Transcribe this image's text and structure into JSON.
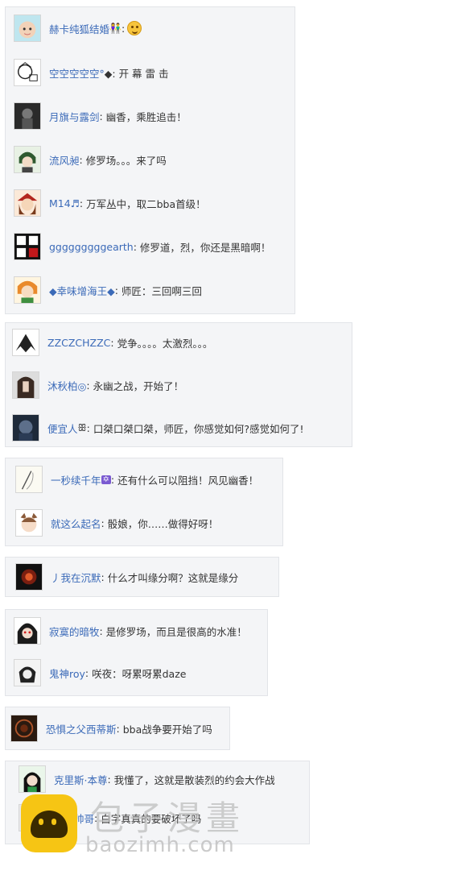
{
  "colors": {
    "username": "#3b6ab8",
    "box_bg": "#f4f5f7",
    "box_border": "#e2e4e8",
    "text": "#333333"
  },
  "groups": [
    {
      "comments": [
        {
          "user": "赫卡纯狐结婚",
          "user_badge": "👫",
          "text": "",
          "emoticon": "face-emoticon-icon"
        },
        {
          "user": "空空空空空°",
          "user_badge": "",
          "text": "◆: 开 幕 雷 击"
        },
        {
          "user": "月旗与露剑",
          "user_badge": "",
          "text": "幽香，乘胜追击！"
        },
        {
          "user": "流风昶",
          "user_badge": "",
          "text": "修罗场。。。来了吗"
        },
        {
          "user": "M14♬",
          "user_badge": "",
          "text": "万军丛中，取二bba首级！"
        },
        {
          "user": "gggggggggearth",
          "user_badge": "",
          "text": "修罗道，烈，你还是黑暗啊！"
        },
        {
          "user": "◆幸味增海王◆",
          "user_badge": "",
          "text": "师匠：三回啊三回"
        }
      ]
    },
    {
      "comments": [
        {
          "user": "ZZCZCHZZC",
          "user_badge": "",
          "text": "党争。。。。太激烈。。。"
        },
        {
          "user": "沐秋柏◎",
          "user_badge": "",
          "text": "永幽之战，开始了！"
        },
        {
          "user": "便宜人",
          "user_badge": "ꕥ",
          "text": "口桀口桀口桀，师匠，你感觉如何?感觉如何了!"
        }
      ]
    },
    {
      "comments": [
        {
          "user": "一秒续千年",
          "user_badge": "✡",
          "text": "还有什么可以阻挡！风见幽香！"
        },
        {
          "user": "就这么起名",
          "user_badge": "",
          "text": "骰娘，你……做得好呀！"
        }
      ]
    },
    {
      "comments": [
        {
          "user": "丿我在沉默",
          "user_badge": "",
          "text": "什么才叫缘分啊？这就是缘分"
        }
      ]
    },
    {
      "comments": [
        {
          "user": "寂寞的暗牧",
          "user_badge": "",
          "text": "是修罗场，而且是很高的水准！"
        },
        {
          "user": "鬼神roy",
          "user_badge": "",
          "text": "咲夜：呀累呀累daze"
        }
      ]
    },
    {
      "comments": [
        {
          "user": "恐惧之父西蒂斯",
          "user_badge": "",
          "text": "bba战争要开始了吗"
        }
      ]
    },
    {
      "comments": [
        {
          "user": "克里斯·本尊",
          "user_badge": "",
          "text": "我懂了，这就是散装烈的约会大作战"
        },
        {
          "user": "天头帅哥",
          "user_badge": "",
          "text": "白字真真的要破坏了吗"
        }
      ]
    }
  ],
  "watermark": {
    "title": "包子漫畫",
    "url": "baozimh.com"
  }
}
